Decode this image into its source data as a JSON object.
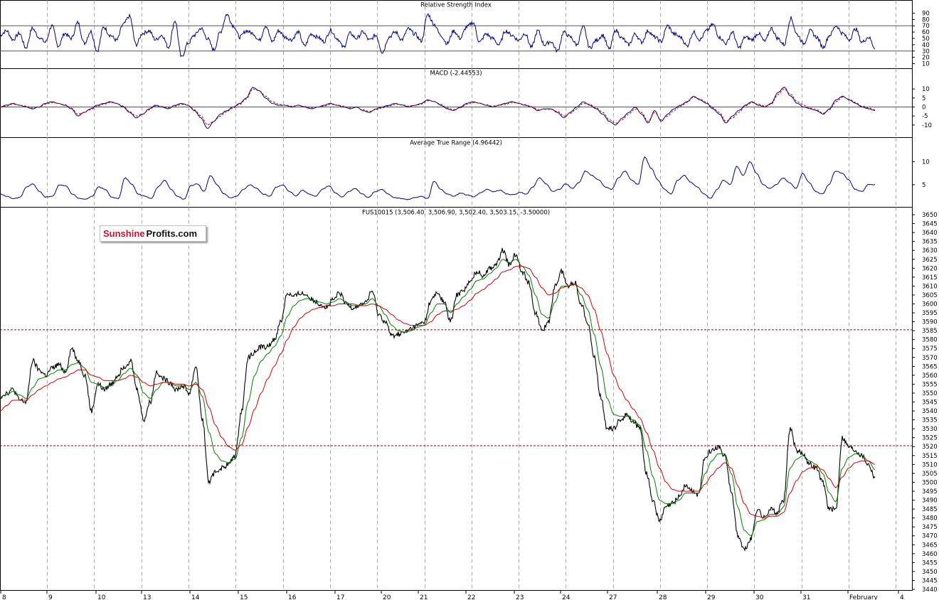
{
  "watermark": {
    "part1": "Sunshine",
    "part2": "Profits.com"
  },
  "chart_data": [
    {
      "type": "line",
      "title": "Relative Strength Index",
      "ylim": [
        5,
        95
      ],
      "yticks": [
        10,
        20,
        30,
        40,
        50,
        60,
        70,
        80,
        90
      ],
      "reference_lines": [
        30,
        70
      ],
      "series": [
        {
          "color": "#000080",
          "values": [
            55,
            62,
            48,
            58,
            35,
            66,
            52,
            44,
            70,
            38,
            58,
            50,
            75,
            42,
            61,
            30,
            68,
            55,
            47,
            72,
            85,
            40,
            58,
            62,
            48,
            55,
            36,
            78,
            20,
            42,
            55,
            66,
            50,
            32,
            60,
            88,
            70,
            52,
            62,
            58,
            47,
            70,
            45,
            62,
            52,
            48,
            60,
            38,
            57,
            52,
            45,
            63,
            50,
            36,
            58,
            50,
            60,
            47,
            55,
            28,
            52,
            60,
            48,
            65,
            57,
            46,
            88,
            72,
            55,
            42,
            62,
            50,
            68,
            75,
            44,
            57,
            50,
            40,
            62,
            55,
            47,
            58,
            36,
            62,
            40,
            45,
            30,
            60,
            52,
            40,
            68,
            35,
            47,
            55,
            33,
            63,
            50,
            40,
            57,
            44,
            62,
            52,
            45,
            70,
            57,
            52,
            38,
            60,
            48,
            62,
            72,
            52,
            42,
            60,
            35,
            52,
            48,
            58,
            45,
            66,
            50,
            40,
            82,
            56,
            42,
            62,
            52,
            36,
            55,
            70,
            58,
            48,
            65,
            44,
            52,
            35
          ]
        }
      ],
      "annotation": ""
    },
    {
      "type": "line",
      "title": "MACD (-2.44553)",
      "ylim": [
        -16,
        16
      ],
      "yticks": [
        -10,
        -5,
        0,
        5,
        10
      ],
      "reference_lines": [
        0
      ],
      "series": [
        {
          "color": "#000080",
          "values": [
            0,
            1,
            2,
            1,
            0,
            -1,
            0,
            2,
            3,
            2,
            1,
            -1,
            -5,
            -3,
            -1,
            1,
            2,
            3,
            2,
            0,
            -3,
            -6,
            -4,
            -1,
            1,
            0,
            -1,
            1,
            2,
            1,
            -2,
            -6,
            -12,
            -8,
            -4,
            -2,
            0,
            2,
            5,
            11,
            9,
            5,
            2,
            1,
            1,
            0,
            1,
            0,
            -1,
            0,
            1,
            2,
            1,
            0,
            -1,
            0,
            -2,
            -3,
            -1,
            0,
            1,
            2,
            1,
            0,
            1,
            2,
            4,
            3,
            1,
            -1,
            -2,
            0,
            2,
            3,
            2,
            1,
            0,
            1,
            2,
            3,
            2,
            1,
            0,
            -2,
            -1,
            -1,
            -3,
            -6,
            -3,
            0,
            3,
            1,
            -1,
            -4,
            -8,
            -10,
            -6,
            -3,
            0,
            -4,
            -9,
            -2,
            -8,
            -4,
            -1,
            1,
            3,
            6,
            4,
            2,
            -1,
            -4,
            -9,
            -5,
            -2,
            1,
            3,
            1,
            0,
            2,
            8,
            11,
            6,
            2,
            0,
            -1,
            -2,
            -4,
            -1,
            4,
            6,
            4,
            2,
            0,
            -1,
            -2
          ]
        },
        {
          "color": "#c00000",
          "values": [
            0,
            0.5,
            1.5,
            1,
            0.5,
            -0.5,
            -0.2,
            1.5,
            2.5,
            2,
            1.2,
            -0.5,
            -4,
            -3,
            -1.5,
            0.5,
            1.5,
            2.5,
            2,
            0.5,
            -2.5,
            -5,
            -4,
            -1.5,
            0.5,
            0.2,
            -0.5,
            0.5,
            1.5,
            1,
            -1.5,
            -5,
            -10,
            -8,
            -5,
            -2.5,
            -0.5,
            1.5,
            4.5,
            10,
            9,
            6,
            3,
            1.5,
            1,
            0.5,
            0.8,
            0.3,
            -0.5,
            -0.2,
            0.5,
            1.5,
            1.2,
            0.5,
            -0.5,
            -0.2,
            -1.5,
            -2.5,
            -1.5,
            -0.5,
            0.5,
            1.5,
            1.2,
            0.5,
            0.8,
            1.5,
            3.5,
            3,
            1.5,
            -0.5,
            -1.5,
            -0.5,
            1.5,
            2.5,
            2.2,
            1.2,
            0.5,
            0.8,
            1.5,
            2.5,
            2.2,
            1.2,
            0.3,
            -1.5,
            -1.2,
            -1.2,
            -2.5,
            -5,
            -3.5,
            -1,
            2,
            1.5,
            -0.5,
            -3,
            -7,
            -9,
            -7,
            -4,
            -1,
            -3,
            -8,
            -3,
            -7,
            -5,
            -2,
            0.5,
            2.5,
            5.5,
            4.5,
            2.5,
            -0.5,
            -3,
            -8,
            -6,
            -3,
            0.5,
            2.5,
            1.5,
            0.5,
            1.5,
            7,
            10,
            7,
            3,
            1,
            -0.5,
            -1.5,
            -3.5,
            -1.5,
            3,
            5.5,
            4.5,
            2.5,
            0.5,
            -0.5,
            -1.5
          ]
        }
      ],
      "annotation": ""
    },
    {
      "type": "line",
      "title": "Average True Range (4.96442)",
      "ylim": [
        0.5,
        13
      ],
      "yticks": [
        5,
        10
      ],
      "series": [
        {
          "color": "#000080",
          "values": [
            3,
            2.5,
            2,
            2.2,
            4.5,
            5.2,
            3.5,
            2.3,
            2.5,
            5,
            4.8,
            3,
            2,
            1.8,
            2.5,
            4.5,
            4,
            2.3,
            2,
            6.5,
            5.2,
            3,
            2.5,
            2,
            4.5,
            6,
            4,
            2.5,
            1.8,
            4.8,
            5.2,
            3.5,
            7,
            5,
            3,
            2.2,
            2.5,
            4,
            5,
            4.2,
            3,
            2.5,
            4.5,
            5,
            3.5,
            2.5,
            3.8,
            3,
            2.5,
            4,
            4.8,
            3.2,
            2.3,
            3.5,
            4.2,
            3,
            2.2,
            3.5,
            4,
            3,
            2.2,
            2,
            1.8,
            2.2,
            2.5,
            2,
            5.8,
            4,
            3,
            2.5,
            3.2,
            2.8,
            2.4,
            3.2,
            4,
            3.5,
            3.8,
            3,
            2.8,
            3.3,
            3,
            4.5,
            6.5,
            5.2,
            3.5,
            4,
            5.2,
            4.2,
            5.5,
            8,
            7,
            6,
            4.5,
            4,
            6.5,
            8,
            6,
            5,
            11,
            8.5,
            6,
            4,
            3,
            6,
            7,
            5.5,
            4.5,
            3,
            2,
            4,
            6,
            5,
            9,
            7,
            10,
            7.5,
            5,
            4.2,
            5,
            6.5,
            5.5,
            4.2,
            7.5,
            5.5,
            3.5,
            3,
            5,
            8,
            7.5,
            6,
            4,
            3.5,
            5,
            5
          ]
        }
      ],
      "annotation": ""
    },
    {
      "type": "line",
      "title": "FUS10015 (3,506.40, 3,506.90, 3,502.40, 3,503.15, -3.50000)",
      "ylim": [
        3440,
        3652
      ],
      "yticks": [
        3440,
        3445,
        3450,
        3455,
        3460,
        3465,
        3470,
        3475,
        3480,
        3485,
        3490,
        3495,
        3500,
        3505,
        3510,
        3515,
        3520,
        3525,
        3530,
        3535,
        3540,
        3545,
        3550,
        3555,
        3560,
        3565,
        3570,
        3575,
        3580,
        3585,
        3590,
        3595,
        3600,
        3605,
        3610,
        3615,
        3620,
        3625,
        3630,
        3635,
        3640,
        3645,
        3650
      ],
      "reference_lines": [
        3585.5,
        3520.5
      ],
      "x_categories": [
        "8",
        "9",
        "10",
        "13",
        "14",
        "15",
        "16",
        "17",
        "20",
        "21",
        "22",
        "23",
        "24",
        "27",
        "28",
        "29",
        "30",
        "31",
        "February",
        "4"
      ],
      "series": [
        {
          "name": "",
          "color": "#000000",
          "values": [
            3548,
            3550,
            3552,
            3546,
            3545,
            3568,
            3563,
            3560,
            3564,
            3566,
            3562,
            3575,
            3568,
            3560,
            3540,
            3555,
            3552,
            3555,
            3560,
            3565,
            3568,
            3552,
            3535,
            3545,
            3562,
            3558,
            3556,
            3552,
            3554,
            3550,
            3565,
            3535,
            3500,
            3506,
            3508,
            3510,
            3515,
            3540,
            3570,
            3573,
            3576,
            3576,
            3580,
            3590,
            3606,
            3604,
            3606,
            3605,
            3602,
            3600,
            3598,
            3602,
            3606,
            3600,
            3598,
            3599,
            3601,
            3607,
            3594,
            3590,
            3582,
            3583,
            3584,
            3586,
            3588,
            3590,
            3602,
            3606,
            3601,
            3590,
            3605,
            3608,
            3612,
            3618,
            3616,
            3620,
            3622,
            3630,
            3622,
            3628,
            3618,
            3612,
            3595,
            3585,
            3590,
            3610,
            3618,
            3610,
            3612,
            3600,
            3590,
            3570,
            3548,
            3530,
            3530,
            3535,
            3538,
            3534,
            3530,
            3505,
            3490,
            3478,
            3486,
            3488,
            3492,
            3498,
            3495,
            3493,
            3515,
            3518,
            3520,
            3515,
            3495,
            3470,
            3462,
            3468,
            3485,
            3480,
            3485,
            3483,
            3490,
            3530,
            3518,
            3516,
            3510,
            3508,
            3500,
            3485,
            3485,
            3525,
            3520,
            3518,
            3515,
            3510,
            3503
          ]
        },
        {
          "name": "",
          "color": "#008000",
          "values": [
            3548,
            3549,
            3551,
            3549,
            3547,
            3553,
            3558,
            3559,
            3561,
            3563,
            3563,
            3566,
            3567,
            3564,
            3556,
            3555,
            3553,
            3554,
            3557,
            3561,
            3564,
            3560,
            3550,
            3547,
            3552,
            3556,
            3556,
            3554,
            3554,
            3552,
            3556,
            3548,
            3528,
            3516,
            3512,
            3511,
            3513,
            3525,
            3545,
            3560,
            3568,
            3572,
            3576,
            3582,
            3593,
            3599,
            3602,
            3603,
            3602,
            3601,
            3600,
            3601,
            3603,
            3601,
            3599,
            3599,
            3600,
            3603,
            3599,
            3594,
            3588,
            3585,
            3584,
            3585,
            3587,
            3588,
            3595,
            3600,
            3600,
            3595,
            3600,
            3604,
            3608,
            3613,
            3614,
            3617,
            3620,
            3625,
            3623,
            3625,
            3621,
            3616,
            3605,
            3594,
            3592,
            3601,
            3610,
            3610,
            3611,
            3605,
            3597,
            3583,
            3565,
            3547,
            3538,
            3537,
            3537,
            3535,
            3532,
            3518,
            3503,
            3490,
            3488,
            3488,
            3490,
            3494,
            3494,
            3494,
            3505,
            3512,
            3516,
            3516,
            3505,
            3486,
            3473,
            3470,
            3478,
            3479,
            3482,
            3482,
            3486,
            3508,
            3513,
            3515,
            3512,
            3510,
            3505,
            3494,
            3489,
            3508,
            3514,
            3516,
            3515,
            3512,
            3507
          ]
        },
        {
          "name": "",
          "color": "#d40000",
          "values": [
            3540,
            3543,
            3546,
            3546,
            3546,
            3549,
            3552,
            3554,
            3556,
            3558,
            3559,
            3561,
            3563,
            3563,
            3560,
            3559,
            3557,
            3557,
            3557,
            3558,
            3560,
            3559,
            3556,
            3554,
            3555,
            3556,
            3556,
            3555,
            3555,
            3554,
            3555,
            3552,
            3542,
            3532,
            3525,
            3520,
            3518,
            3521,
            3531,
            3541,
            3550,
            3558,
            3565,
            3572,
            3580,
            3587,
            3592,
            3595,
            3597,
            3598,
            3599,
            3599,
            3600,
            3600,
            3600,
            3599,
            3599,
            3600,
            3599,
            3597,
            3594,
            3591,
            3589,
            3588,
            3588,
            3588,
            3590,
            3594,
            3596,
            3596,
            3597,
            3599,
            3602,
            3606,
            3608,
            3611,
            3614,
            3618,
            3619,
            3621,
            3621,
            3620,
            3615,
            3609,
            3605,
            3606,
            3609,
            3610,
            3611,
            3609,
            3605,
            3597,
            3585,
            3572,
            3560,
            3552,
            3546,
            3541,
            3536,
            3528,
            3518,
            3508,
            3500,
            3496,
            3495,
            3495,
            3495,
            3495,
            3499,
            3504,
            3508,
            3511,
            3508,
            3498,
            3488,
            3482,
            3481,
            3480,
            3481,
            3481,
            3483,
            3494,
            3501,
            3506,
            3508,
            3509,
            3507,
            3502,
            3497,
            3503,
            3508,
            3511,
            3512,
            3512,
            3510
          ]
        }
      ],
      "annotation": ""
    }
  ]
}
